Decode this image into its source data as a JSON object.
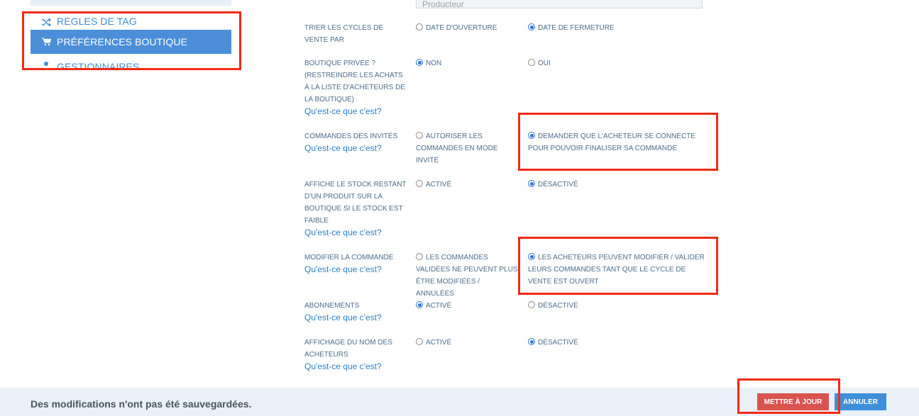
{
  "sidebar": {
    "items": [
      {
        "label": "Règles de tag",
        "icon": "shuffle-icon"
      },
      {
        "label": "Préférences boutique",
        "icon": "cart-icon",
        "active": true
      },
      {
        "label": "Gestionnaires",
        "icon": "user-icon"
      }
    ]
  },
  "top_field": {
    "label": "",
    "value": "Producteur"
  },
  "help_text": "Qu'est-ce que c'est?",
  "rows": [
    {
      "label": "Trier les cycles de vente par",
      "has_help": false,
      "options": [
        {
          "label": "Date d'ouverture",
          "selected": false
        },
        {
          "label": "Date de fermeture",
          "selected": true
        }
      ]
    },
    {
      "label": "Boutique privée ? (restreindre les achats à la liste d'acheteurs de la boutique)",
      "has_help": true,
      "options": [
        {
          "label": "Non",
          "selected": true
        },
        {
          "label": "Oui",
          "selected": false
        }
      ]
    },
    {
      "label": "Commandes des invités",
      "has_help": true,
      "options": [
        {
          "label": "Autoriser les commandes en mode invité",
          "selected": false
        },
        {
          "label": "Demander que l'acheteur se connecte pour pouvoir finaliser sa commande",
          "selected": true
        }
      ]
    },
    {
      "label": "Affiche le stock restant d'un produit sur la boutique si le stock est faible",
      "has_help": true,
      "options": [
        {
          "label": "Activé",
          "selected": false
        },
        {
          "label": "Désactivé",
          "selected": true
        }
      ]
    },
    {
      "label": "Modifier la commande",
      "has_help": true,
      "options": [
        {
          "label": "Les commandes validées ne peuvent plus être modifiées / annulées",
          "selected": false
        },
        {
          "label": "Les acheteurs peuvent modifier / valider leurs commandes tant que le cycle de vente est ouvert",
          "selected": true
        }
      ]
    },
    {
      "label": "Abonnements",
      "has_help": true,
      "options": [
        {
          "label": "Activé",
          "selected": true
        },
        {
          "label": "Désactivé",
          "selected": false
        }
      ]
    },
    {
      "label": "Affichage du nom des acheteurs",
      "has_help": true,
      "options": [
        {
          "label": "Activé",
          "selected": false
        },
        {
          "label": "Désactivé",
          "selected": true
        }
      ]
    }
  ],
  "footer": {
    "unsaved_message": "Des modifications n'ont pas été sauvegardées.",
    "update_label": "Mettre à jour",
    "cancel_label": "Annuler"
  },
  "colors": {
    "highlight": "#f22a16",
    "accent": "#4a8fd8",
    "update": "#d9534f",
    "cancel": "#3f8fd8"
  }
}
